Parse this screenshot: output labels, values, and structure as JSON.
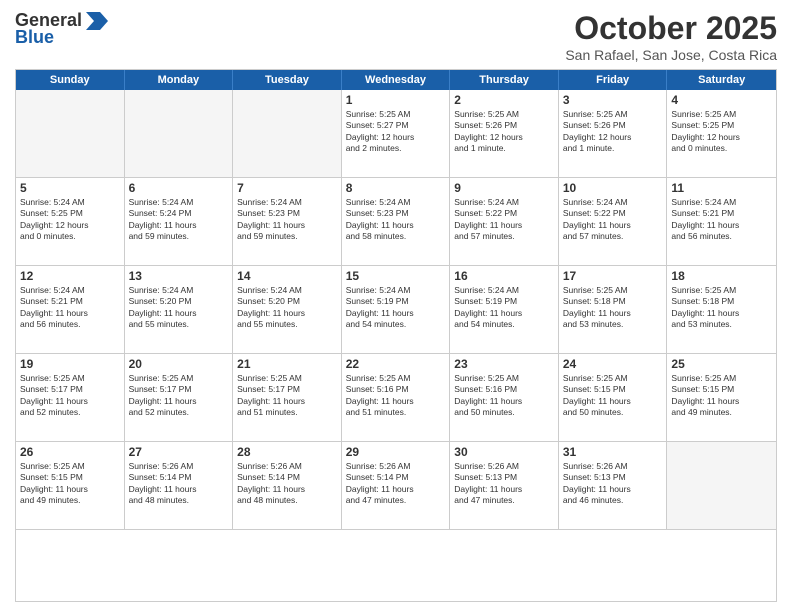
{
  "logo": {
    "general": "General",
    "blue": "Blue",
    "arrow_color": "#1a5fa8"
  },
  "header": {
    "month": "October 2025",
    "location": "San Rafael, San Jose, Costa Rica"
  },
  "weekdays": [
    "Sunday",
    "Monday",
    "Tuesday",
    "Wednesday",
    "Thursday",
    "Friday",
    "Saturday"
  ],
  "weeks": [
    [
      {
        "day": "",
        "info": ""
      },
      {
        "day": "",
        "info": ""
      },
      {
        "day": "",
        "info": ""
      },
      {
        "day": "1",
        "info": "Sunrise: 5:25 AM\nSunset: 5:27 PM\nDaylight: 12 hours\nand 2 minutes."
      },
      {
        "day": "2",
        "info": "Sunrise: 5:25 AM\nSunset: 5:26 PM\nDaylight: 12 hours\nand 1 minute."
      },
      {
        "day": "3",
        "info": "Sunrise: 5:25 AM\nSunset: 5:26 PM\nDaylight: 12 hours\nand 1 minute."
      },
      {
        "day": "4",
        "info": "Sunrise: 5:25 AM\nSunset: 5:25 PM\nDaylight: 12 hours\nand 0 minutes."
      }
    ],
    [
      {
        "day": "5",
        "info": "Sunrise: 5:24 AM\nSunset: 5:25 PM\nDaylight: 12 hours\nand 0 minutes."
      },
      {
        "day": "6",
        "info": "Sunrise: 5:24 AM\nSunset: 5:24 PM\nDaylight: 11 hours\nand 59 minutes."
      },
      {
        "day": "7",
        "info": "Sunrise: 5:24 AM\nSunset: 5:23 PM\nDaylight: 11 hours\nand 59 minutes."
      },
      {
        "day": "8",
        "info": "Sunrise: 5:24 AM\nSunset: 5:23 PM\nDaylight: 11 hours\nand 58 minutes."
      },
      {
        "day": "9",
        "info": "Sunrise: 5:24 AM\nSunset: 5:22 PM\nDaylight: 11 hours\nand 57 minutes."
      },
      {
        "day": "10",
        "info": "Sunrise: 5:24 AM\nSunset: 5:22 PM\nDaylight: 11 hours\nand 57 minutes."
      },
      {
        "day": "11",
        "info": "Sunrise: 5:24 AM\nSunset: 5:21 PM\nDaylight: 11 hours\nand 56 minutes."
      }
    ],
    [
      {
        "day": "12",
        "info": "Sunrise: 5:24 AM\nSunset: 5:21 PM\nDaylight: 11 hours\nand 56 minutes."
      },
      {
        "day": "13",
        "info": "Sunrise: 5:24 AM\nSunset: 5:20 PM\nDaylight: 11 hours\nand 55 minutes."
      },
      {
        "day": "14",
        "info": "Sunrise: 5:24 AM\nSunset: 5:20 PM\nDaylight: 11 hours\nand 55 minutes."
      },
      {
        "day": "15",
        "info": "Sunrise: 5:24 AM\nSunset: 5:19 PM\nDaylight: 11 hours\nand 54 minutes."
      },
      {
        "day": "16",
        "info": "Sunrise: 5:24 AM\nSunset: 5:19 PM\nDaylight: 11 hours\nand 54 minutes."
      },
      {
        "day": "17",
        "info": "Sunrise: 5:25 AM\nSunset: 5:18 PM\nDaylight: 11 hours\nand 53 minutes."
      },
      {
        "day": "18",
        "info": "Sunrise: 5:25 AM\nSunset: 5:18 PM\nDaylight: 11 hours\nand 53 minutes."
      }
    ],
    [
      {
        "day": "19",
        "info": "Sunrise: 5:25 AM\nSunset: 5:17 PM\nDaylight: 11 hours\nand 52 minutes."
      },
      {
        "day": "20",
        "info": "Sunrise: 5:25 AM\nSunset: 5:17 PM\nDaylight: 11 hours\nand 52 minutes."
      },
      {
        "day": "21",
        "info": "Sunrise: 5:25 AM\nSunset: 5:17 PM\nDaylight: 11 hours\nand 51 minutes."
      },
      {
        "day": "22",
        "info": "Sunrise: 5:25 AM\nSunset: 5:16 PM\nDaylight: 11 hours\nand 51 minutes."
      },
      {
        "day": "23",
        "info": "Sunrise: 5:25 AM\nSunset: 5:16 PM\nDaylight: 11 hours\nand 50 minutes."
      },
      {
        "day": "24",
        "info": "Sunrise: 5:25 AM\nSunset: 5:15 PM\nDaylight: 11 hours\nand 50 minutes."
      },
      {
        "day": "25",
        "info": "Sunrise: 5:25 AM\nSunset: 5:15 PM\nDaylight: 11 hours\nand 49 minutes."
      }
    ],
    [
      {
        "day": "26",
        "info": "Sunrise: 5:25 AM\nSunset: 5:15 PM\nDaylight: 11 hours\nand 49 minutes."
      },
      {
        "day": "27",
        "info": "Sunrise: 5:26 AM\nSunset: 5:14 PM\nDaylight: 11 hours\nand 48 minutes."
      },
      {
        "day": "28",
        "info": "Sunrise: 5:26 AM\nSunset: 5:14 PM\nDaylight: 11 hours\nand 48 minutes."
      },
      {
        "day": "29",
        "info": "Sunrise: 5:26 AM\nSunset: 5:14 PM\nDaylight: 11 hours\nand 47 minutes."
      },
      {
        "day": "30",
        "info": "Sunrise: 5:26 AM\nSunset: 5:13 PM\nDaylight: 11 hours\nand 47 minutes."
      },
      {
        "day": "31",
        "info": "Sunrise: 5:26 AM\nSunset: 5:13 PM\nDaylight: 11 hours\nand 46 minutes."
      },
      {
        "day": "",
        "info": ""
      }
    ]
  ]
}
